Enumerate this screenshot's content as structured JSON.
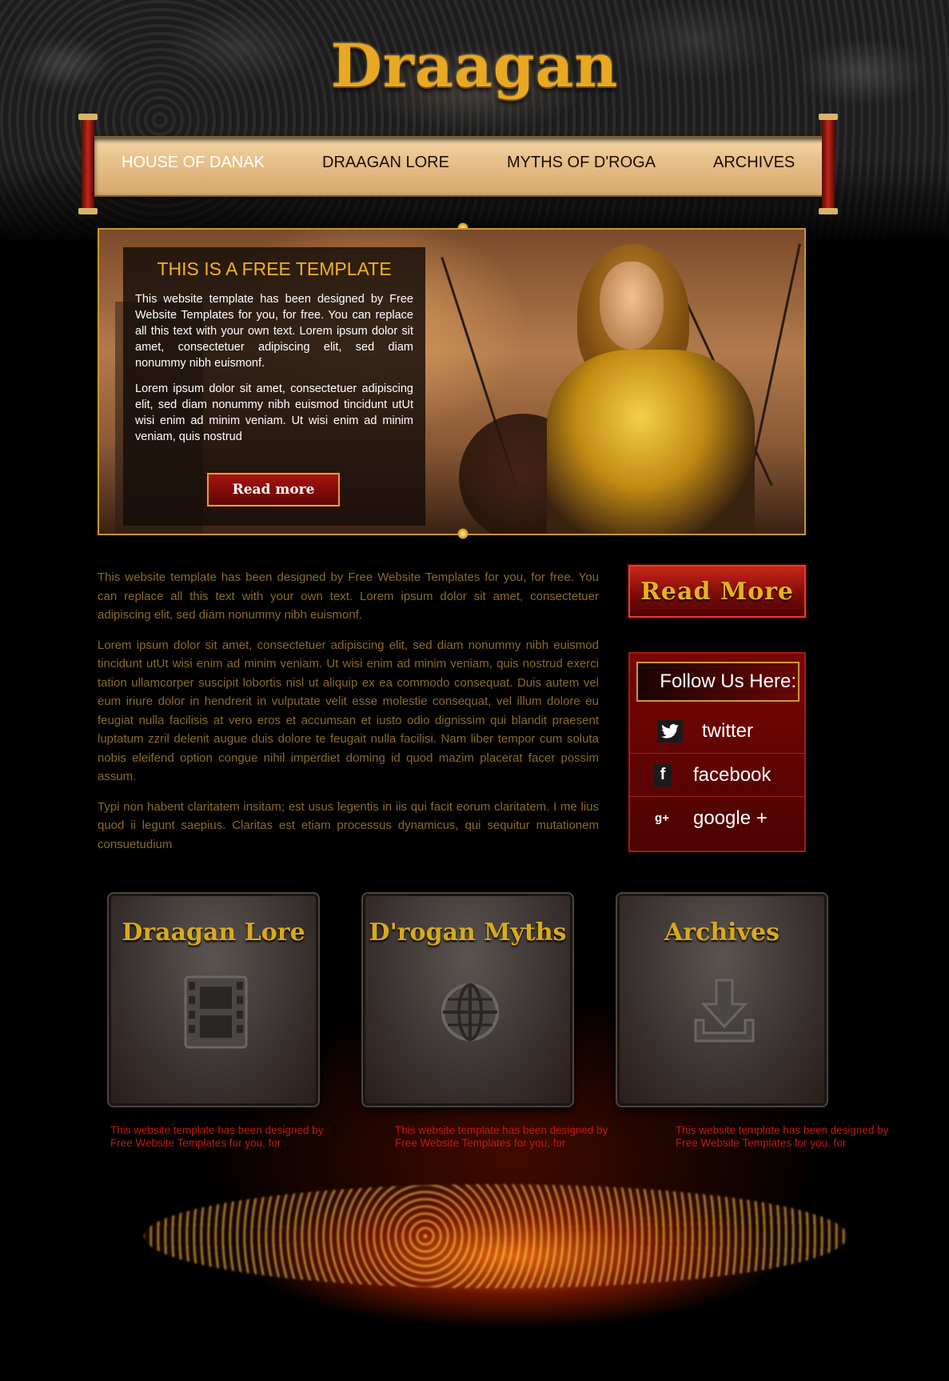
{
  "site": {
    "logo": "Draagan"
  },
  "nav": {
    "items": [
      {
        "label": "HOUSE OF DANAK",
        "active": true
      },
      {
        "label": "DRAAGAN LORE",
        "active": false
      },
      {
        "label": "MYTHS OF D'ROGA",
        "active": false
      },
      {
        "label": "ARCHIVES",
        "active": false
      }
    ]
  },
  "hero": {
    "title": "THIS IS A FREE TEMPLATE",
    "paragraphs": [
      "This website template has been designed by Free Website Templates for you, for free. You can replace all this text with your own text. Lorem ipsum dolor sit amet, consectetuer adipiscing elit, sed diam nonummy nibh euismonf.",
      "Lorem ipsum dolor sit amet, consectetuer adipiscing elit, sed diam nonummy nibh euismod tincidunt utUt wisi enim ad minim veniam. Ut wisi enim ad minim veniam, quis nostrud"
    ],
    "button_label": "Read more"
  },
  "main": {
    "paragraphs": [
      "This website template has been designed by Free Website Templates for you, for free. You can replace all this text with your own text. Lorem ipsum dolor sit amet, consectetuer adipiscing elit, sed diam nonummy nibh euismonf.",
      "Lorem ipsum dolor sit amet, consectetuer adipiscing elit, sed diam nonummy nibh euismod tincidunt utUt wisi enim ad minim veniam. Ut wisi enim ad minim veniam, quis nostrud exerci tation ullamcorper suscipit lobortis nisl ut aliquip ex ea commodo consequat. Duis autem vel eum iriure dolor in hendrerit in vulputate velit esse molestie consequat, vel illum dolore eu feugiat nulla facilisis at vero eros et accumsan et iusto odio dignissim qui blandit praesent luptatum zzril delenit augue duis dolore te feugait nulla facilisi. Nam liber tempor cum soluta nobis eleifend option congue nihil imperdiet doming id quod mazim placerat facer possim assum.",
      "Typi non habent claritatem insitam; est usus legentis in iis qui facit eorum claritatem. I me lius quod ii legunt saepius. Claritas est etiam processus dynamicus, qui sequitur mutationem consuetudium"
    ]
  },
  "sidebar": {
    "read_more_label": "Read More",
    "follow_title": "Follow Us Here:",
    "social": [
      {
        "label": "twitter",
        "icon": "twitter-icon",
        "glyph": "🐦"
      },
      {
        "label": "facebook",
        "icon": "facebook-icon",
        "glyph": "f"
      },
      {
        "label": "google +",
        "icon": "google-plus-icon",
        "glyph": "g+"
      }
    ]
  },
  "features": [
    {
      "title": "Draagan Lore",
      "icon": "film-icon",
      "description": "This website template has been designed by Free Website Templates for you, for"
    },
    {
      "title": "D'rogan Myths",
      "icon": "globe-icon",
      "description": "This website template has been designed by Free Website Templates for you, for"
    },
    {
      "title": "Archives",
      "icon": "download-icon",
      "description": "This website template has been designed by Free Website Templates for you, for"
    }
  ],
  "colors": {
    "accent_gold": "#e8a823",
    "body_text": "#8a6a28",
    "feature_text": "#c01a10",
    "social_red": "#7a0604"
  }
}
